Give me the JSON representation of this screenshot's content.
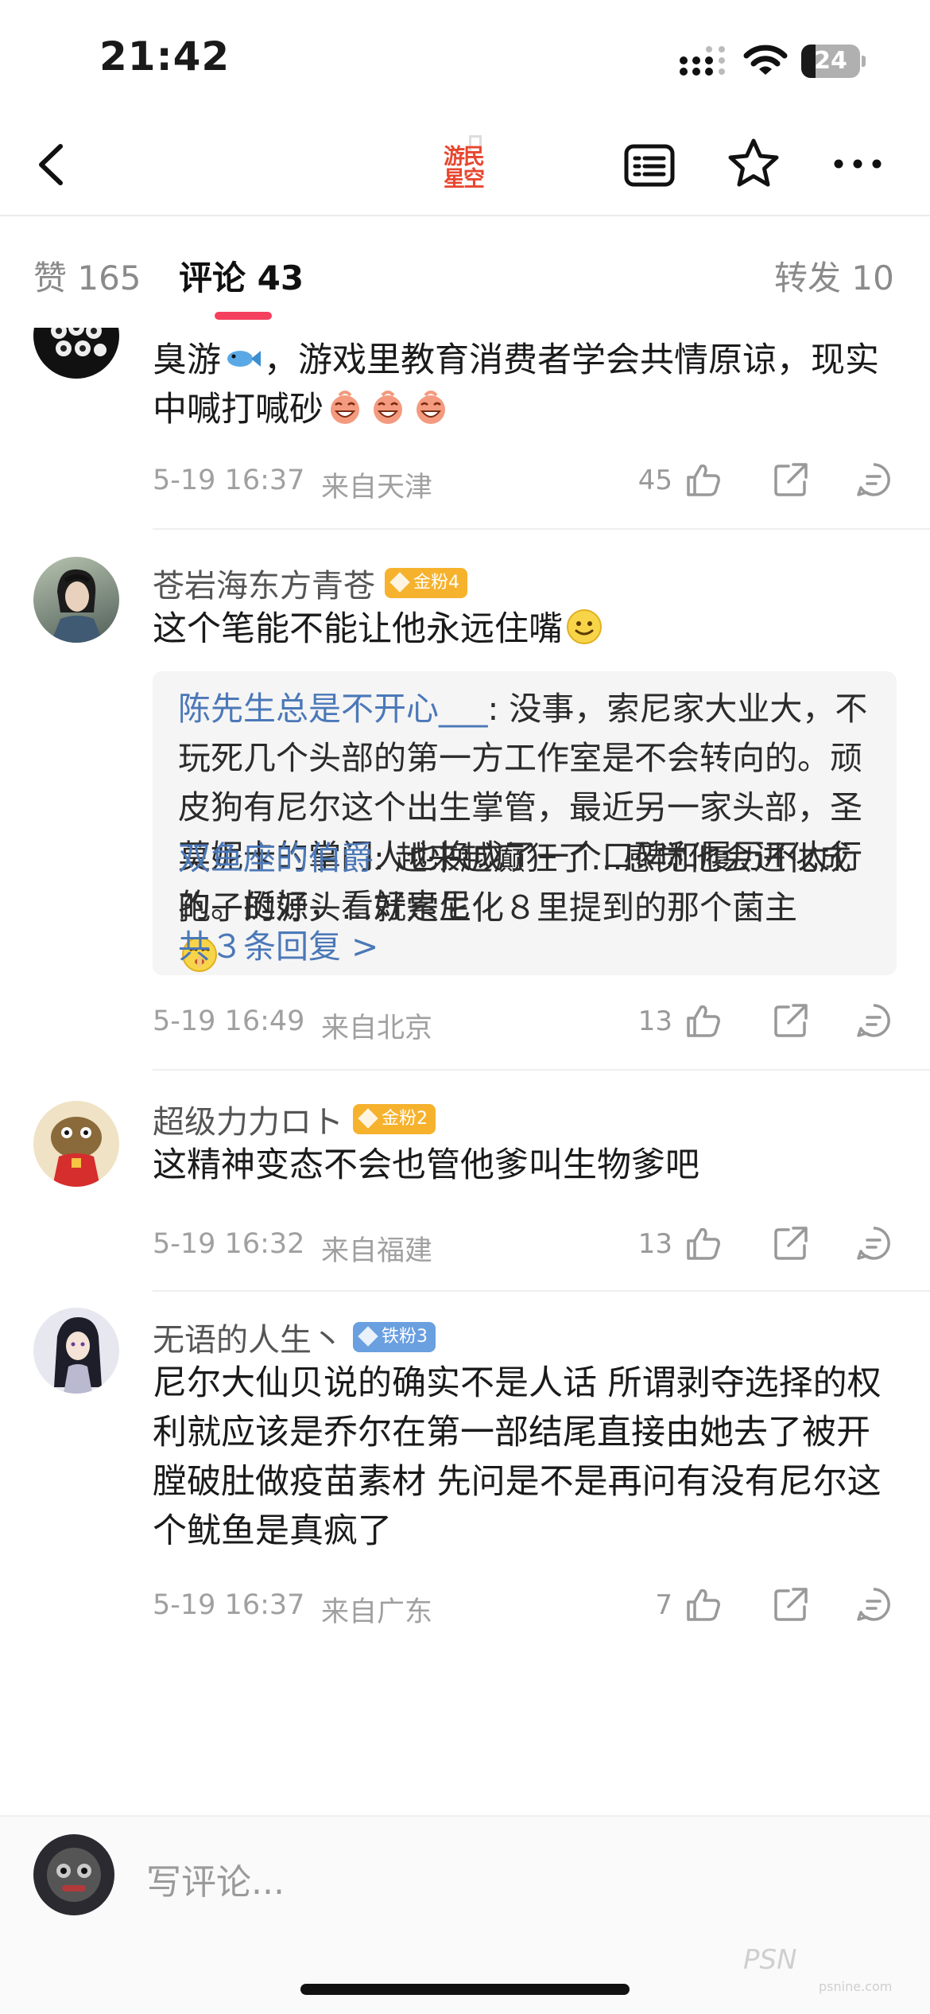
{
  "status_bar": {
    "time": "21:42",
    "battery": "24",
    "battery_level": 0.24
  },
  "nav": {
    "logo_text": "游民星空",
    "logo_line1": "游民",
    "logo_line2": "星空"
  },
  "tabs": {
    "likes": "赞 165",
    "comments": "评论 43",
    "reposts": "转发 10",
    "active": "comments",
    "accent": "#f43f5e"
  },
  "comments": [
    {
      "text": "臭游🐟，游戏里教育消费者学会共情原谅，现实中喊打喊砂😆😆😆",
      "text_part1": "臭游",
      "text_part2": "，游戏里教育消费者学会共情原谅，现实中喊打喊砂",
      "time": "5-19 16:37",
      "location": "来自天津",
      "likes": "45"
    },
    {
      "username": "苍岩海东方青苍",
      "badge": "金粉4",
      "text": "这个笔能不能让他永远住嘴",
      "time": "5-19 16:49",
      "location": "来自北京",
      "likes": "13",
      "replies": [
        {
          "author": "陈先生总是不开心___",
          "text": ": 没事，索尼家大业大，不玩死几个头部的第一方工作室是不会转向的。顽皮狗有尼尔这个出生掌管，最近另一家头部，圣莫妮卡的掌门人也换成了一个口碑和履历不太行的。挺好，看好索尼"
        },
        {
          "author": "双鱼座的伯爵",
          "text": ": 越来越癫狂了…感觉他会进化成孢子的源头…就是生化８里提到的那个菌主"
        }
      ],
      "reply_count_label": "共３条回复 >"
    },
    {
      "username": "超级力力ロト",
      "badge": "金粉2",
      "text": "这精神变态不会也管他爹叫生物爹吧",
      "time": "5-19 16:32",
      "location": "来自福建",
      "likes": "13"
    },
    {
      "username": "无语的人生丶",
      "badge": "铁粉3",
      "text": "尼尔大仙贝说的确实不是人话 所谓剥夺选择的权利就应该是乔尔在第一部结尾直接由她去了被开膛破肚做疫苗素材 先问是不是再问有没有尼尔这个鱿鱼是真疯了",
      "time": "5-19 16:37",
      "location": "来自广东",
      "likes": "7"
    }
  ],
  "composer": {
    "placeholder": "写评论..."
  },
  "watermark": {
    "main": "PSN",
    "sub": "psnine.com"
  },
  "colors": {
    "link": "#4b78b8",
    "gold_badge": "#f6b22d",
    "iron_badge": "#6a9fe0",
    "brand_red": "#e8462f"
  }
}
